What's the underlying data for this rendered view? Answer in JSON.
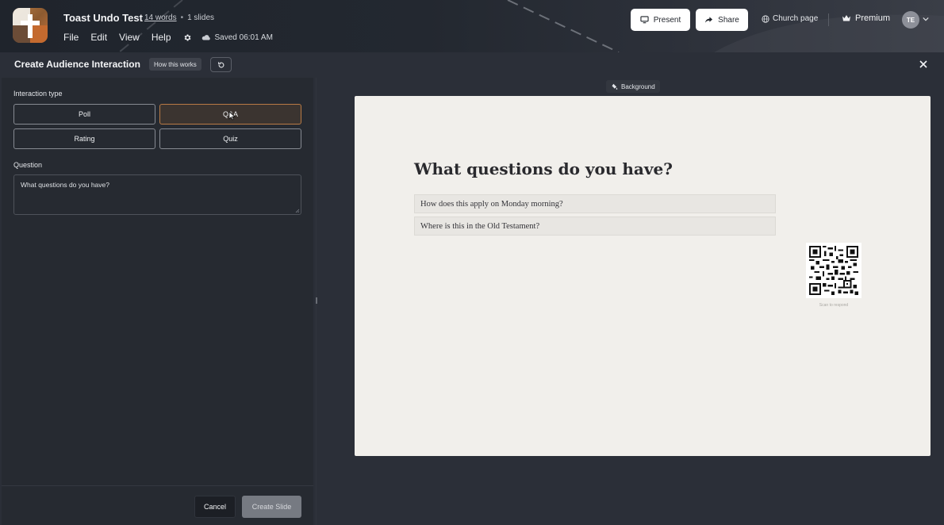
{
  "header": {
    "doc_title": "Toast Undo Test",
    "word_count": "14 words",
    "separator": "•",
    "slide_count": "1 slides",
    "menu": [
      "File",
      "Edit",
      "View",
      "Help"
    ],
    "saved_status": "Saved 06:01 AM",
    "present_label": "Present",
    "share_label": "Share",
    "church_page_label": "Church page",
    "premium_label": "Premium",
    "avatar_initials": "TE"
  },
  "subheader": {
    "title": "Create Audience Interaction",
    "how_label": "How this works"
  },
  "panel": {
    "interaction_type_label": "Interaction type",
    "types": [
      "Poll",
      "Q&A",
      "Rating",
      "Quiz"
    ],
    "selected_type": "Q&A",
    "question_label": "Question",
    "question_value": "What questions do you have?",
    "cancel_label": "Cancel",
    "create_label": "Create Slide"
  },
  "preview": {
    "background_label": "Background",
    "slide_title": "What questions do you have?",
    "answers": [
      "How does this apply on Monday morning?",
      "Where is this in the Old Testament?"
    ],
    "qr_caption": "Scan to respond"
  },
  "colors": {
    "selected_border": "#b87a45",
    "slide_bg": "#f1efeb",
    "panel_bg": "#262a31"
  },
  "icons": [
    "app-logo",
    "monitor-icon",
    "share-arrow-icon",
    "globe-icon",
    "crown-icon",
    "chevron-down-icon",
    "gear-icon",
    "cloud-icon",
    "undo-icon",
    "close-icon",
    "paint-bucket-icon",
    "qr-code"
  ]
}
